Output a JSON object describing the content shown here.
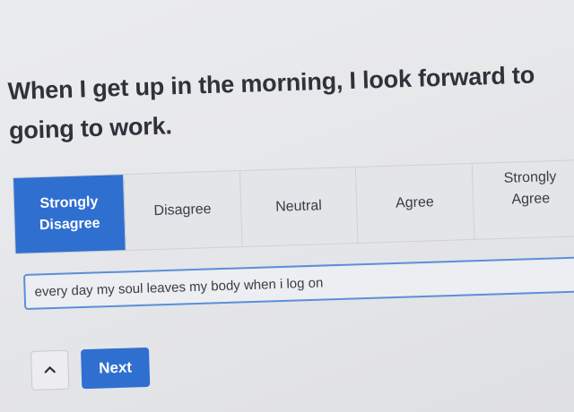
{
  "question": {
    "line1": "When I get up in the morning, I look forward to",
    "line2": "going to work."
  },
  "scale": {
    "options": [
      {
        "line1": "Strongly",
        "line2": "Disagree",
        "selected": true
      },
      {
        "line1": "Disagree",
        "line2": "",
        "selected": false
      },
      {
        "line1": "Neutral",
        "line2": "",
        "selected": false
      },
      {
        "line1": "Agree",
        "line2": "",
        "selected": false
      },
      {
        "line1": "Strongly",
        "line2": "Agree",
        "selected": false
      }
    ]
  },
  "answer": {
    "value": "every day my soul leaves my body when i log on"
  },
  "navigation": {
    "back_icon": "chevron-up-icon",
    "next_label": "Next"
  },
  "colors": {
    "accent": "#2f6fd0",
    "focus_border": "#5b8fd8"
  }
}
